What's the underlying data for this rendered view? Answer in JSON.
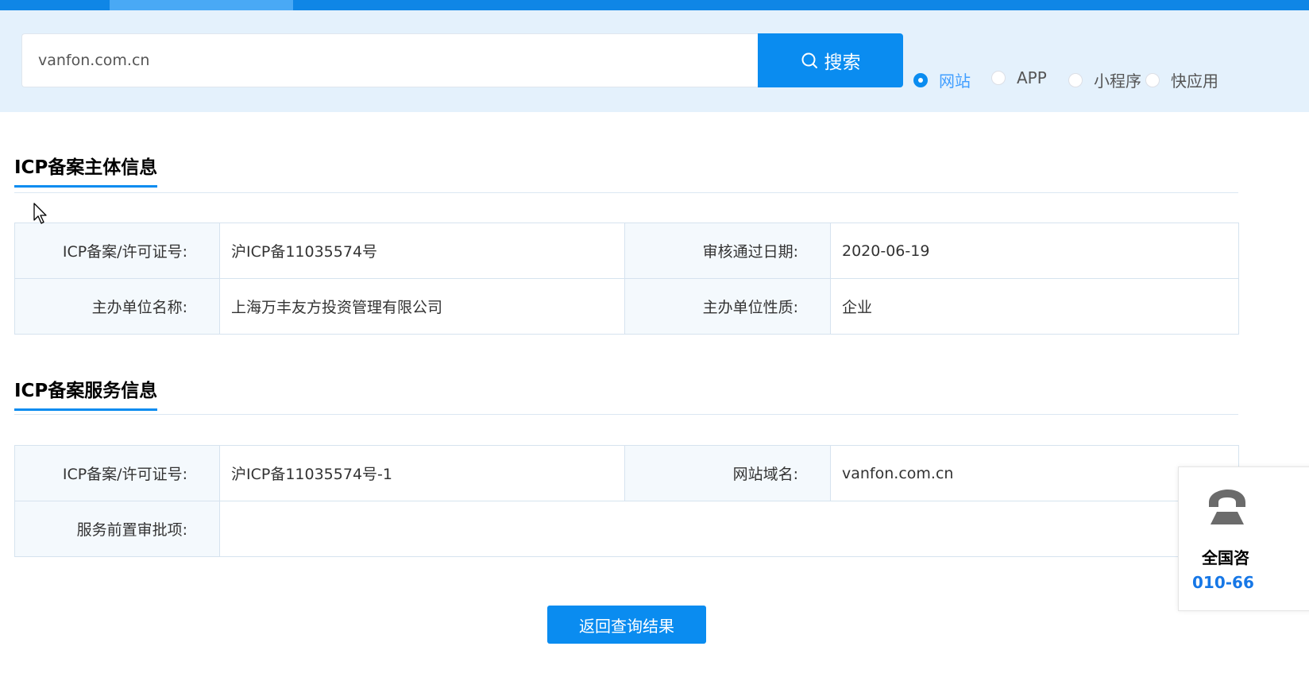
{
  "search": {
    "value": "vanfon.com.cn",
    "button_label": "搜索"
  },
  "search_types": [
    {
      "label": "网站",
      "checked": true
    },
    {
      "label": "APP",
      "checked": false
    },
    {
      "label": "小程序",
      "checked": false
    },
    {
      "label": "快应用",
      "checked": false
    }
  ],
  "entity_section": {
    "title": "ICP备案主体信息",
    "rows": [
      {
        "label1": "ICP备案/许可证号:",
        "value1": "沪ICP备11035574号",
        "label2": "审核通过日期:",
        "value2": "2020-06-19"
      },
      {
        "label1": "主办单位名称:",
        "value1": "上海万丰友方投资管理有限公司",
        "label2": "主办单位性质:",
        "value2": "企业"
      }
    ]
  },
  "service_section": {
    "title": "ICP备案服务信息",
    "rows": [
      {
        "label1": "ICP备案/许可证号:",
        "value1": "沪ICP备11035574号-1",
        "label2": "网站域名:",
        "value2": "vanfon.com.cn"
      },
      {
        "label1": "服务前置审批项:",
        "value1": ""
      }
    ]
  },
  "return_button": "返回查询结果",
  "hotline": {
    "icon": "phone-icon",
    "title": "全国咨",
    "number": "010-66"
  },
  "colors": {
    "accent": "#0a8cf0",
    "topbar": "#0f86e6",
    "band": "#e4f1fc"
  }
}
